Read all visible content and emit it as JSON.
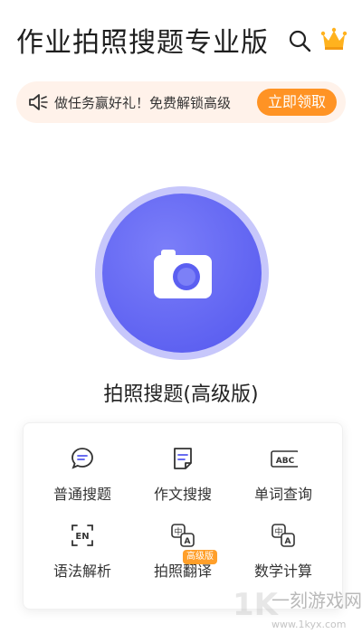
{
  "header": {
    "title": "作业拍照搜题专业版"
  },
  "banner": {
    "text": "做任务赢好礼！免费解锁高级",
    "cta": "立即领取"
  },
  "main": {
    "camera_label": "拍照搜题(高级版)"
  },
  "tools": [
    {
      "label": "普通搜题",
      "icon": "chat-search-icon"
    },
    {
      "label": "作文搜搜",
      "icon": "document-icon"
    },
    {
      "label": "单词查询",
      "icon": "abc-icon"
    },
    {
      "label": "语法解析",
      "icon": "en-icon"
    },
    {
      "label": "拍照翻译",
      "icon": "translate-icon",
      "badge": "高级版"
    },
    {
      "label": "数学计算",
      "icon": "translate-icon"
    }
  ],
  "watermark": {
    "text": "一刻游戏网",
    "url": "www.1kyx.com"
  },
  "colors": {
    "accent": "#5357ee",
    "cta": "#ff9324",
    "banner_bg": "#fff2ea"
  }
}
